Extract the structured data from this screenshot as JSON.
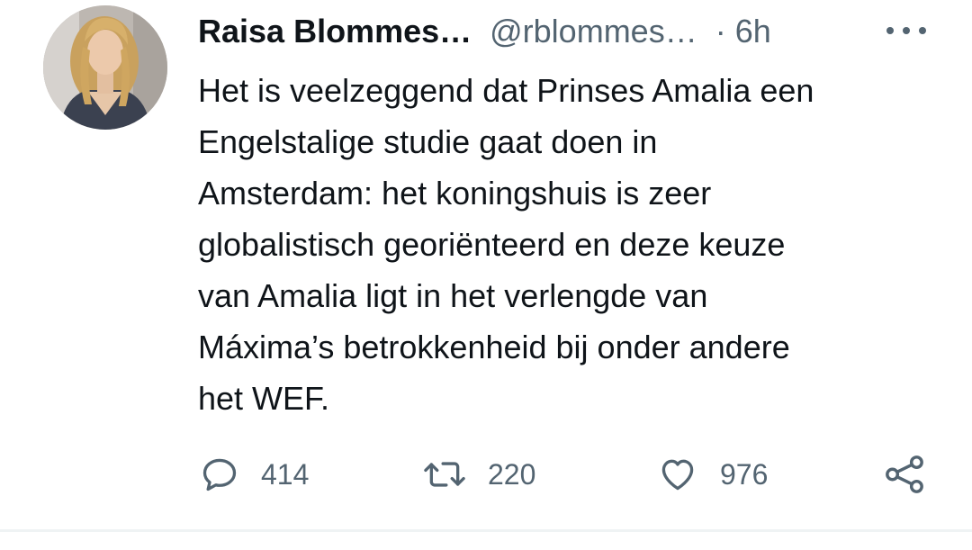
{
  "tweet": {
    "author_name": "Raisa Blommes…",
    "handle": "@rblommes…",
    "separator": "·",
    "time": "6h",
    "more_icon": "more-horizontal-icon",
    "text_lines": [
      "Het is veelzeggend dat Prinses Amalia een",
      "Engelstalige studie gaat doen in",
      "Amsterdam: het koningshuis is zeer",
      "globalistisch georiënteerd en deze keuze",
      "van Amalia ligt in het verlengde van",
      "Máxima’s betrokkenheid bij onder andere",
      "het WEF."
    ]
  },
  "actions": {
    "reply": {
      "icon": "reply-icon",
      "count": "414"
    },
    "retweet": {
      "icon": "retweet-icon",
      "count": "220"
    },
    "like": {
      "icon": "heart-icon",
      "count": "976"
    },
    "share": {
      "icon": "share-icon"
    }
  },
  "colors": {
    "text_primary": "#0f1419",
    "text_secondary": "#536471",
    "divider": "#eff3f4"
  }
}
